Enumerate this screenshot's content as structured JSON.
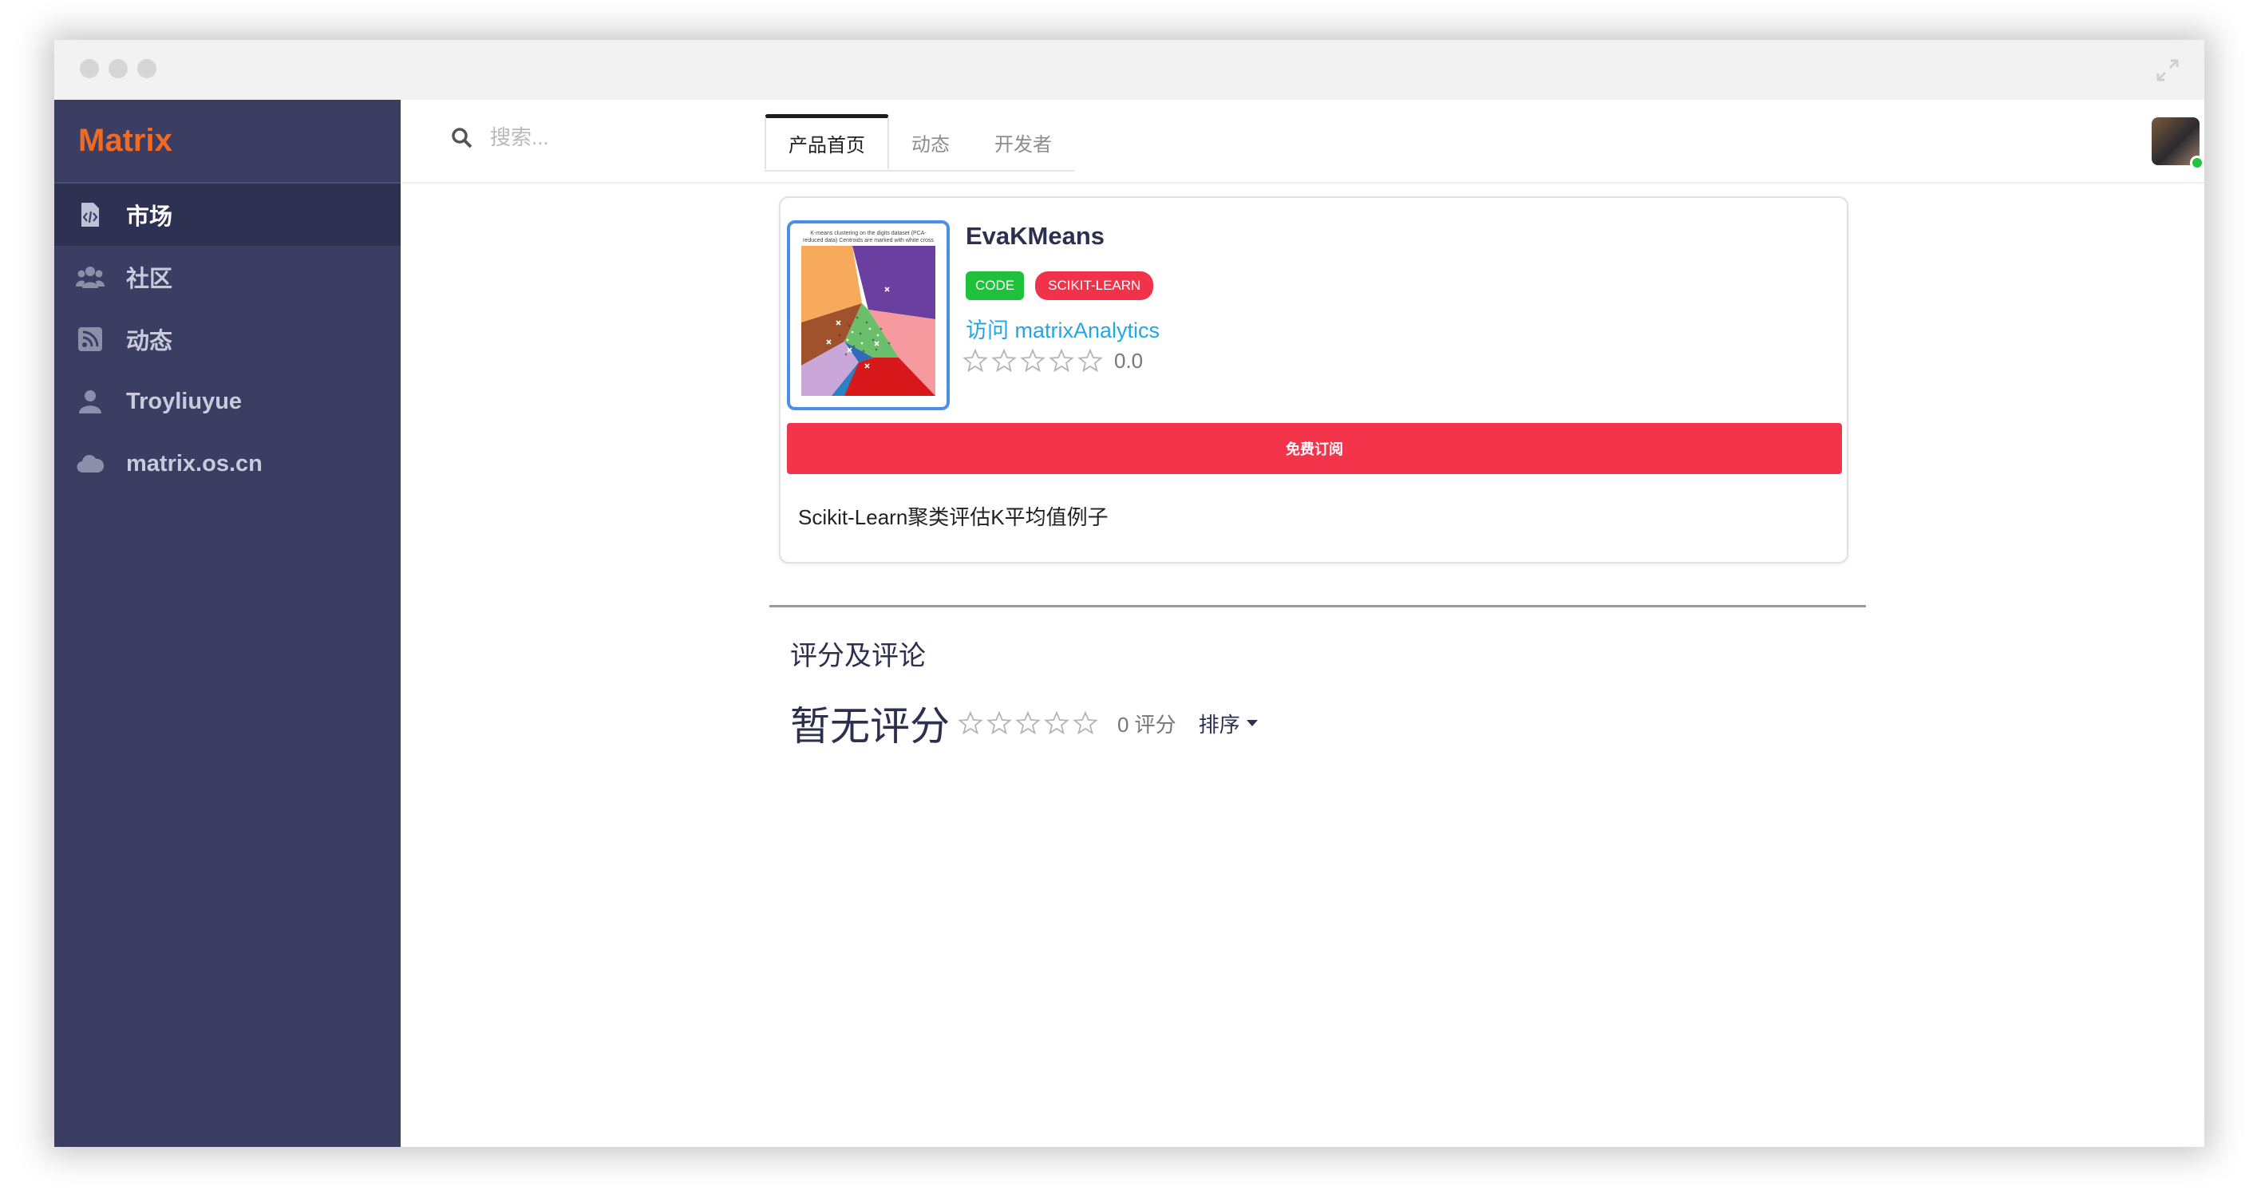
{
  "app": {
    "brand": "Matrix"
  },
  "sidebar": {
    "items": [
      {
        "label": "市场",
        "icon": "code-file-icon",
        "active": true
      },
      {
        "label": "社区",
        "icon": "users-icon"
      },
      {
        "label": "动态",
        "icon": "rss-icon"
      },
      {
        "label": "Troyliuyue",
        "icon": "user-icon"
      },
      {
        "label": "matrix.os.cn",
        "icon": "cloud-icon"
      }
    ]
  },
  "header": {
    "search_placeholder": "搜索...",
    "tabs": [
      {
        "label": "产品首页",
        "active": true
      },
      {
        "label": "动态"
      },
      {
        "label": "开发者"
      }
    ]
  },
  "product": {
    "name": "EvaKMeans",
    "thumbnail_caption": "K-means clustering on the digits dataset (PCA-reduced data) Centroids are marked with white cross",
    "tags": [
      "CODE",
      "SCIKIT-LEARN"
    ],
    "visit_link": "访问 matrixAnalytics",
    "rating": "0.0",
    "stars_filled": 0,
    "stars_total": 5,
    "subscribe_label": "免费订阅",
    "description": "Scikit-Learn聚类评估K平均值例子"
  },
  "reviews": {
    "title": "评分及评论",
    "no_rating": "暂无评分",
    "count": "0 评分",
    "sort_label": "排序"
  },
  "colors": {
    "sidebar_bg": "#3b3d63",
    "brand": "#f26a21",
    "primary_red": "#f3344b",
    "code_tag": "#1fc13b",
    "link": "#23a6e6"
  }
}
